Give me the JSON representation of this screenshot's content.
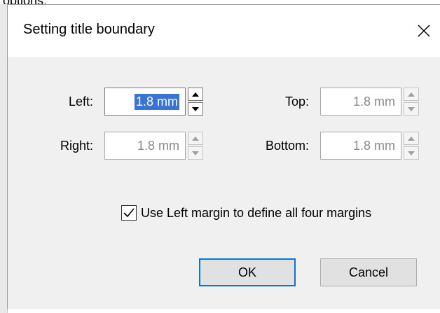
{
  "background_text": "options:",
  "dialog": {
    "title": "Setting title boundary",
    "close_glyph": "✕"
  },
  "fields": {
    "left": {
      "label": "Left:",
      "value": "1.8 mm",
      "active": true
    },
    "top": {
      "label": "Top:",
      "value": "1.8 mm",
      "active": false
    },
    "right": {
      "label": "Right:",
      "value": "1.8 mm",
      "active": false
    },
    "bottom": {
      "label": "Bottom:",
      "value": "1.8 mm",
      "active": false
    }
  },
  "checkbox": {
    "label": "Use Left margin to define all four margins",
    "checked": true
  },
  "buttons": {
    "ok": "OK",
    "cancel": "Cancel"
  },
  "colors": {
    "selection": "#3a73d6",
    "default_button_border": "#0078d7"
  },
  "icons": {
    "close": "close-icon",
    "up": "arrow-up-icon",
    "down": "arrow-down-icon",
    "check": "checkmark-icon"
  }
}
